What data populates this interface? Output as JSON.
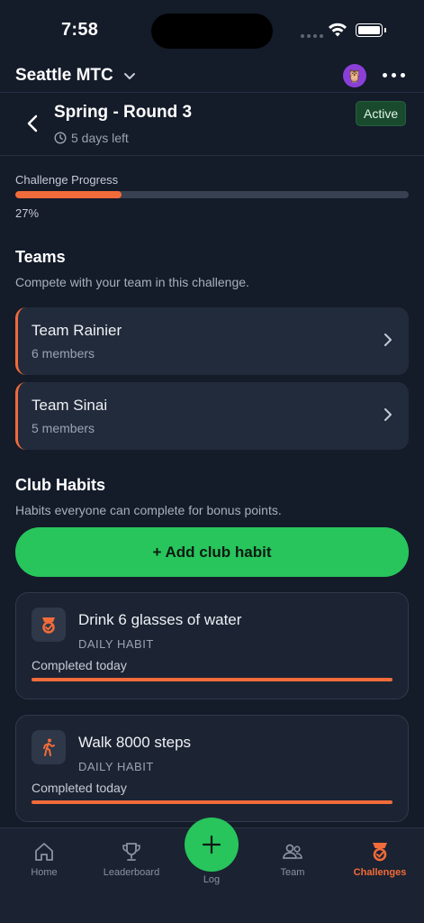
{
  "status_bar": {
    "time": "7:58"
  },
  "club": {
    "name": "Seattle MTC"
  },
  "challenge": {
    "title": "Spring - Round 3",
    "time_left": "5 days left",
    "status": "Active",
    "progress_label": "Challenge Progress",
    "progress_value": 27,
    "progress_text": "27%"
  },
  "teams": {
    "title": "Teams",
    "subtitle": "Compete with your team in this challenge.",
    "items": [
      {
        "name": "Team Rainier",
        "members": "6 members"
      },
      {
        "name": "Team Sinai",
        "members": "5 members"
      }
    ]
  },
  "club_habits": {
    "title": "Club Habits",
    "subtitle": "Habits everyone can complete for bonus points.",
    "add_label": "+ Add club habit",
    "items": [
      {
        "name": "Drink 6 glasses of water",
        "type": "DAILY HABIT",
        "status": "Completed today",
        "icon": "challenge-badge-icon",
        "progress": 1.0
      },
      {
        "name": "Walk 8000 steps",
        "type": "DAILY HABIT",
        "status": "Completed today",
        "icon": "walking-icon",
        "progress": 1.0
      }
    ]
  },
  "tabs": [
    {
      "label": "Home",
      "icon": "home-icon"
    },
    {
      "label": "Leaderboard",
      "icon": "trophy-icon"
    },
    {
      "label": "Log",
      "icon": "plus-icon"
    },
    {
      "label": "Team",
      "icon": "team-icon"
    },
    {
      "label": "Challenges",
      "icon": "challenge-badge-icon",
      "active": true
    }
  ],
  "colors": {
    "accent": "#f26b3a",
    "primary_green": "#27c55c",
    "background": "#141b29",
    "card": "#222b3b"
  }
}
